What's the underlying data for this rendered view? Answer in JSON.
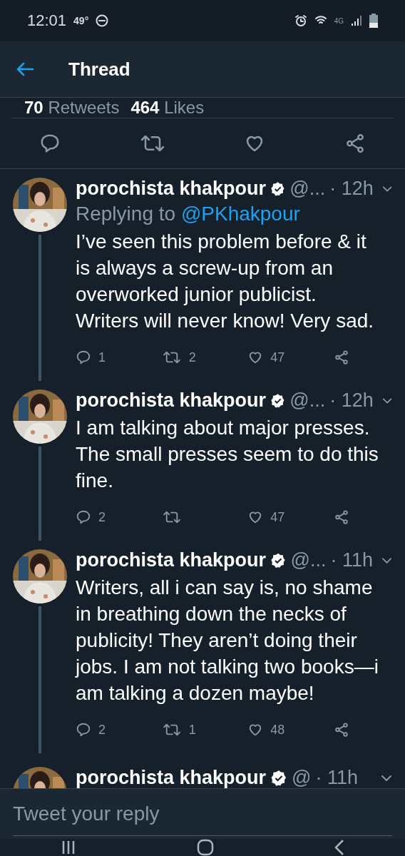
{
  "status_bar": {
    "time": "12:01",
    "temperature": "49°",
    "network": "4G"
  },
  "header": {
    "title": "Thread"
  },
  "stats": [
    {
      "count": "70",
      "label": "Retweets"
    },
    {
      "count": "464",
      "label": "Likes"
    }
  ],
  "tweets": [
    {
      "name": "porochista khakpour",
      "verified": true,
      "handle": "@...",
      "time": "· 12h",
      "replying_prefix": "Replying to",
      "replying_to": "@PKhakpour",
      "text": "I’ve seen this problem before & it is always a screw-up from an overworked junior publicist. Writers will never know! Very sad.",
      "replies": "1",
      "retweets": "2",
      "likes": "47",
      "thread_line": true
    },
    {
      "name": "porochista khakpour",
      "verified": true,
      "handle": "@...",
      "time": "· 12h",
      "text": "I am talking about major presses. The small presses seem to do this fine.",
      "replies": "2",
      "likes": "47",
      "thread_line": true
    },
    {
      "name": "porochista khakpour",
      "verified": true,
      "handle": "@...",
      "time": "· 11h",
      "text": "Writers, all i can say is, no shame in breathing down the necks of publicity! They aren’t doing their jobs. I am not talking two books—i am talking a dozen maybe!",
      "replies": "2",
      "retweets": "1",
      "likes": "48",
      "thread_line": true
    },
    {
      "name": "porochista khakpour",
      "verified": true,
      "handle": "@",
      "time": "· 11h",
      "thread_line": false
    }
  ],
  "reply_field": {
    "placeholder": "Tweet your reply"
  }
}
